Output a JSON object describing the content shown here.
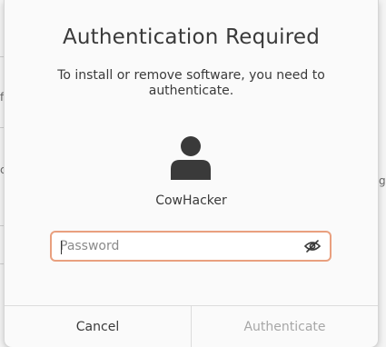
{
  "dialog": {
    "title": "Authentication Required",
    "message": "To install or remove software, you need to authenticate.",
    "username": "CowHacker",
    "password": {
      "value": "",
      "placeholder": "Password"
    },
    "buttons": {
      "cancel": "Cancel",
      "authenticate": "Authenticate"
    }
  },
  "background": {
    "glyphs": [
      "f",
      "c",
      "g"
    ]
  },
  "colors": {
    "focus_border": "#e9a07f",
    "disabled_text": "#a7a7a7",
    "text": "#3a3a3a"
  }
}
